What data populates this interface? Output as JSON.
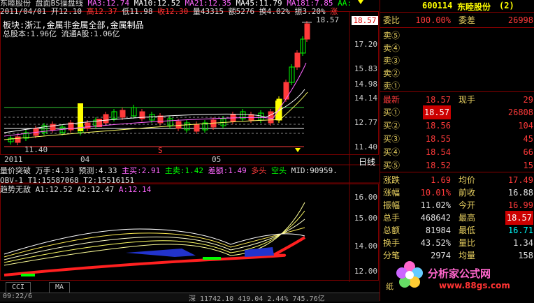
{
  "header": {
    "line1": [
      {
        "t": "东睦股份",
        "c": "#e0e0e0"
      },
      {
        "t": "盘面BS操盘线",
        "c": "#e0e0e0"
      },
      {
        "t": "MA3:12.74",
        "c": "#ff66ff"
      },
      {
        "t": "MA10:12.52",
        "c": "#ffffff"
      },
      {
        "t": "MA21:12.35",
        "c": "#ff66ff"
      },
      {
        "t": "MA45:11.79",
        "c": "#ffffff"
      },
      {
        "t": "MA181:7.85",
        "c": "#ff66ff"
      },
      {
        "t": "AA:",
        "c": "#00ff00"
      }
    ],
    "line2": [
      {
        "t": "2011/04/01",
        "c": "#e0e0e0"
      },
      {
        "t": "开12.10",
        "c": "#e0e0e0"
      },
      {
        "t": "高12.37",
        "c": "#ff3a3a"
      },
      {
        "t": "低11.98",
        "c": "#e0e0e0"
      },
      {
        "t": "收12.30",
        "c": "#ff3a3a"
      },
      {
        "t": "量43315",
        "c": "#e0e0e0"
      },
      {
        "t": "额5276",
        "c": "#e0e0e0"
      },
      {
        "t": "换4.02%",
        "c": "#e0e0e0"
      },
      {
        "t": "振3.20%",
        "c": "#e0e0e0"
      },
      {
        "t": "涨",
        "c": "#ff3a3a"
      }
    ],
    "sector": "板块:浙江,金属非金属全部,金属制品",
    "shares": "总股本:1.96亿 流通A股:1.06亿"
  },
  "main_chart": {
    "price_ticks": [
      "17.20",
      "15.83",
      "14.98",
      "14.14",
      "12.77",
      "11.40"
    ],
    "high_label": "18.57",
    "current_price": "18.57",
    "low_label": "11.40",
    "x_labels": [
      "2011",
      "04",
      "05"
    ],
    "period": "日线",
    "marker_s": "S"
  },
  "indicator1": {
    "text": [
      {
        "t": "量价突破",
        "c": "#e0e0e0"
      },
      {
        "t": "万手:4.33",
        "c": "#e0e0e0"
      },
      {
        "t": "预测:4.33",
        "c": "#e0e0e0"
      },
      {
        "t": "主买:2.91",
        "c": "#ff66ff"
      },
      {
        "t": "主卖:1.42",
        "c": "#00ff00"
      },
      {
        "t": "差额:1.49",
        "c": "#ff66ff"
      },
      {
        "t": "多头",
        "c": "#ff3a3a"
      },
      {
        "t": "空头",
        "c": "#00ff00"
      },
      {
        "t": "MID:90959.",
        "c": "#e0e0e0"
      }
    ]
  },
  "indicator2": {
    "text": [
      {
        "t": "OBV-1",
        "c": "#e0e0e0"
      },
      {
        "t": "T1:15587068",
        "c": "#e0e0e0"
      },
      {
        "t": "T2:15516151",
        "c": "#e0e0e0"
      }
    ]
  },
  "indicator3": {
    "text": [
      {
        "t": "趋势无敌",
        "c": "#e0e0e0"
      },
      {
        "t": "A1:12.52",
        "c": "#e0e0e0"
      },
      {
        "t": "A2:12.47",
        "c": "#e0e0e0"
      },
      {
        "t": "A:12.14",
        "c": "#ff66ff"
      }
    ],
    "ticks": [
      "16.00",
      "15.00",
      "14.00",
      "12.00"
    ]
  },
  "tabs": [
    "CCI",
    "MA"
  ],
  "bottom_status": {
    "left": "09:22/6",
    "mid": "深 11742.10  419.04  2.44%  745.76亿"
  },
  "right_panel": {
    "code": "600114",
    "name": "东睦股份",
    "count": "(2)",
    "weibi_label": "委比",
    "weibi_value": "100.00%",
    "weicha_label": "委差",
    "weicha_value": "26998",
    "sell_labels": [
      "卖⑤",
      "卖④",
      "卖③",
      "卖②",
      "卖①"
    ],
    "latest_label": "最新",
    "latest_value": "18.57",
    "xianshou_label": "现手",
    "xianshou_value": "29",
    "buy_rows": [
      {
        "label": "买①",
        "price": "18.57",
        "vol": "26808"
      },
      {
        "label": "买②",
        "price": "18.56",
        "vol": "104"
      },
      {
        "label": "买③",
        "price": "18.55",
        "vol": "45"
      },
      {
        "label": "买④",
        "price": "18.54",
        "vol": "66"
      },
      {
        "label": "买⑤",
        "price": "18.52",
        "vol": "15"
      }
    ],
    "stats": [
      {
        "l1": "涨跌",
        "v1": "1.69",
        "c1": "red",
        "l2": "均价",
        "v2": "17.49",
        "c2": "red"
      },
      {
        "l1": "涨幅",
        "v1": "10.01%",
        "c1": "red",
        "l2": "前收",
        "v2": "16.88",
        "c2": "wht"
      },
      {
        "l1": "振幅",
        "v1": "11.02%",
        "c1": "wht",
        "l2": "今开",
        "v2": "16.99",
        "c2": "red"
      },
      {
        "l1": "总手",
        "v1": "468642",
        "c1": "wht",
        "l2": "最高",
        "v2": "18.57",
        "c2": "hl"
      },
      {
        "l1": "总额",
        "v1": "81984",
        "c1": "wht",
        "l2": "最低",
        "v2": "16.71",
        "c2": "cyn"
      },
      {
        "l1": "换手",
        "v1": "43.52%",
        "c1": "wht",
        "l2": "量比",
        "v2": "1.34",
        "c2": "wht"
      },
      {
        "l1": "分笔",
        "v1": "2974",
        "c1": "wht",
        "l2": "均量",
        "v2": "158",
        "c2": "wht"
      }
    ],
    "watermark_cn": "分析家公式网",
    "watermark_url": "www.88gs.com",
    "footer": "纸"
  },
  "colors": {
    "up": "#ff3a3a",
    "down": "#00ffff",
    "yellow": "#ffff00",
    "grid": "#7a0000"
  }
}
